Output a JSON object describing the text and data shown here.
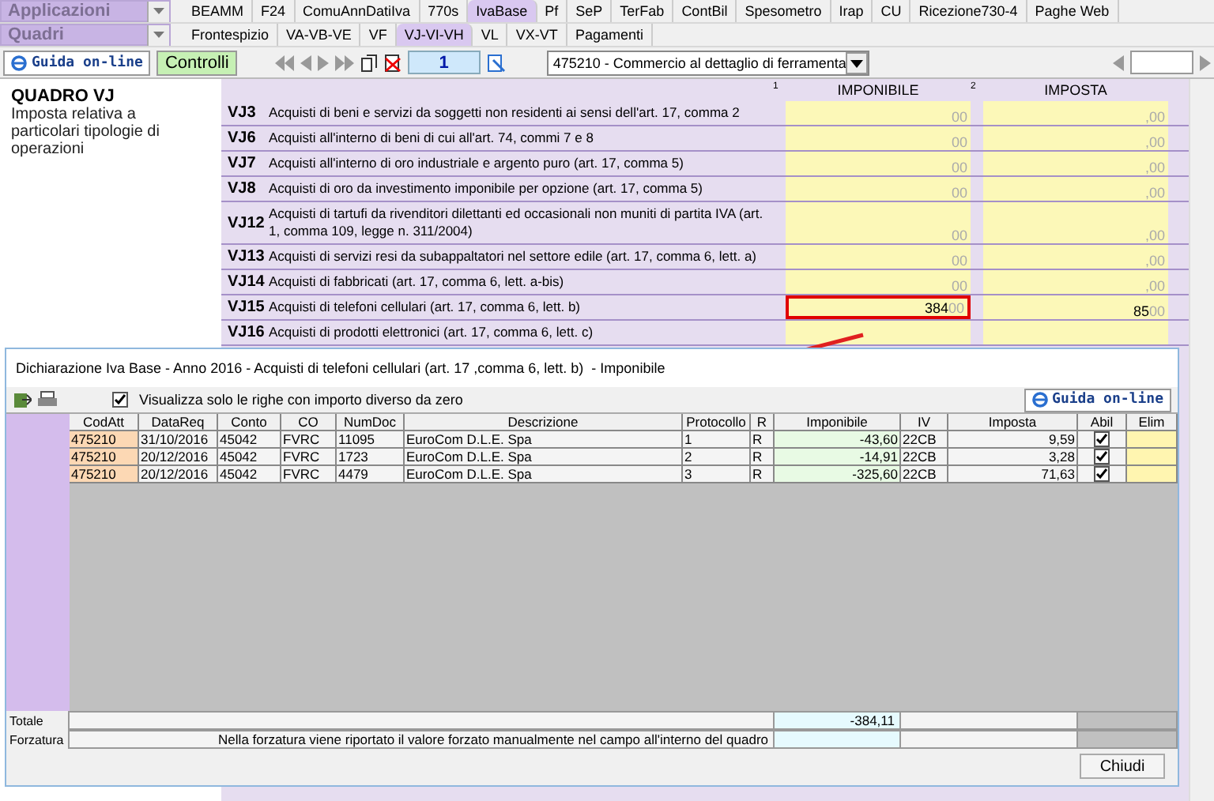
{
  "app_menu": {
    "label": "Applicazioni"
  },
  "app_tabs": [
    {
      "label": "BEAMM",
      "selected": false
    },
    {
      "label": "F24",
      "selected": false
    },
    {
      "label": "ComuAnnDatiIva",
      "selected": false
    },
    {
      "label": "770s",
      "selected": false
    },
    {
      "label": "IvaBase",
      "selected": true
    },
    {
      "label": "Pf",
      "selected": false
    },
    {
      "label": "SeP",
      "selected": false
    },
    {
      "label": "TerFab",
      "selected": false
    },
    {
      "label": "ContBil",
      "selected": false
    },
    {
      "label": "Spesometro",
      "selected": false
    },
    {
      "label": "Irap",
      "selected": false
    },
    {
      "label": "CU",
      "selected": false
    },
    {
      "label": "Ricezione730-4",
      "selected": false
    },
    {
      "label": "Paghe Web",
      "selected": false
    }
  ],
  "section_menu": {
    "label": "Quadri"
  },
  "section_tabs": [
    {
      "label": "Frontespizio",
      "selected": false
    },
    {
      "label": "VA-VB-VE",
      "selected": false
    },
    {
      "label": "VF",
      "selected": false
    },
    {
      "label": "VJ-VI-VH",
      "selected": true
    },
    {
      "label": "VL",
      "selected": false
    },
    {
      "label": "VX-VT",
      "selected": false
    },
    {
      "label": "Pagamenti",
      "selected": false
    }
  ],
  "toolbar": {
    "help_button": "Guida on-line",
    "check_button": "Controlli",
    "page": "1",
    "activity": "475210 - Commercio al dettaglio di ferramenta"
  },
  "form": {
    "title": "QUADRO VJ",
    "subtitle": "Imposta relativa a particolari tipologie di operazioni",
    "column_1_number": "1",
    "column_1": "IMPONIBILE",
    "column_2_number": "2",
    "column_2": "IMPOSTA",
    "rows": [
      {
        "code": "VJ3",
        "description": "Acquisti di beni e servizi da soggetti non residenti ai sensi dell'art. 17, comma 2",
        "imponibile": "",
        "imponibile_dec": "00",
        "imposta": "",
        "imposta_dec": ",00",
        "highlighted": false
      },
      {
        "code": "VJ6",
        "description": "Acquisti all'interno di beni di cui all'art. 74, commi 7 e 8",
        "imponibile": "",
        "imponibile_dec": "00",
        "imposta": "",
        "imposta_dec": ",00",
        "highlighted": false
      },
      {
        "code": "VJ7",
        "description": "Acquisti all'interno di oro industriale e argento puro (art. 17, comma 5)",
        "imponibile": "",
        "imponibile_dec": "00",
        "imposta": "",
        "imposta_dec": ",00",
        "highlighted": false
      },
      {
        "code": "VJ8",
        "description": "Acquisti di oro da investimento imponibile per opzione (art. 17, comma 5)",
        "imponibile": "",
        "imponibile_dec": "00",
        "imposta": "",
        "imposta_dec": ",00",
        "highlighted": false
      },
      {
        "code": "VJ12",
        "description": "Acquisti di tartufi da rivenditori dilettanti ed occasionali non muniti di partita IVA (art. 1, comma 109, legge n. 311/2004)",
        "imponibile": "",
        "imponibile_dec": "00",
        "imposta": "",
        "imposta_dec": ",00",
        "highlighted": false
      },
      {
        "code": "VJ13",
        "description": "Acquisti di servizi resi da subappaltatori nel settore edile (art. 17, comma 6, lett. a)",
        "imponibile": "",
        "imponibile_dec": "00",
        "imposta": "",
        "imposta_dec": ",00",
        "highlighted": false
      },
      {
        "code": "VJ14",
        "description": "Acquisti di fabbricati (art. 17, comma 6, lett. a-bis)",
        "imponibile": "",
        "imponibile_dec": "00",
        "imposta": "",
        "imposta_dec": ",00",
        "highlighted": false
      },
      {
        "code": "VJ15",
        "description": "Acquisti di telefoni cellulari (art. 17, comma 6, lett. b)",
        "imponibile": "384",
        "imponibile_dec": "00",
        "imposta": "85",
        "imposta_dec": "00",
        "highlighted": true
      },
      {
        "code": "VJ16",
        "description": "Acquisti di prodotti elettronici (art. 17, comma 6, lett. c)",
        "imponibile": "",
        "imponibile_dec": "",
        "imposta": "",
        "imposta_dec": "",
        "highlighted": false
      }
    ]
  },
  "dialog": {
    "title": "Dichiarazione Iva Base - Anno 2016 - Acquisti di telefoni cellulari (art. 17 ,comma 6, lett. b)  - Imponibile",
    "filter": {
      "label": "Visualizza solo le righe con importo diverso da zero",
      "checked": true
    },
    "help_button": "Guida on-line",
    "columns": [
      "CodAtt",
      "DataReq",
      "Conto",
      "CO",
      "NumDoc",
      "Descrizione",
      "Protocollo",
      "R",
      "Imponibile",
      "IV",
      "Imposta",
      "Abil",
      "Elim"
    ],
    "rows": [
      {
        "cells": [
          "475210",
          "31/10/2016",
          "45042",
          "FVRC",
          "11095",
          "EuroCom D.L.E. Spa",
          "1",
          "R",
          "-43,60",
          "22CB",
          "9,59"
        ],
        "enabled": true
      },
      {
        "cells": [
          "475210",
          "20/12/2016",
          "45042",
          "FVRC",
          "1723",
          "EuroCom D.L.E. Spa",
          "2",
          "R",
          "-14,91",
          "22CB",
          "3,28"
        ],
        "enabled": true
      },
      {
        "cells": [
          "475210",
          "20/12/2016",
          "45042",
          "FVRC",
          "4479",
          "EuroCom D.L.E. Spa",
          "3",
          "R",
          "-325,60",
          "22CB",
          "71,63"
        ],
        "enabled": true
      }
    ],
    "total": {
      "label": "Totale",
      "value": "-384,11"
    },
    "override": {
      "label": "Forzatura",
      "note": "Nella forzatura viene riportato il valore forzato manualmente nel campo all'interno del quadro"
    },
    "close_button": "Chiudi"
  }
}
